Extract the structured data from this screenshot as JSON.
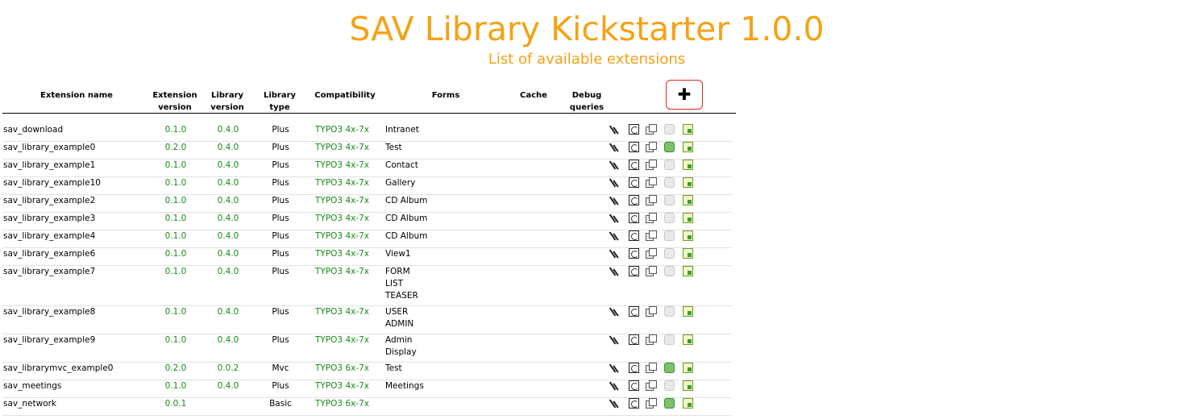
{
  "header": {
    "title": "SAV Library Kickstarter 1.0.0",
    "subtitle": "List of available extensions"
  },
  "columns": {
    "name": "Extension name",
    "ext_version_1": "Extension",
    "ext_version_2": "version",
    "lib_version_1": "Library",
    "lib_version_2": "version",
    "lib_type_1": "Library",
    "lib_type_2": "type",
    "compat": "Compatibility",
    "forms": "Forms",
    "cache": "Cache",
    "debug_1": "Debug",
    "debug_2": "queries"
  },
  "add_button": {
    "symbol": "✚"
  },
  "icons": [
    "edit-icon",
    "regenerate-icon",
    "copy-icon",
    "cache-icon",
    "document-icon"
  ],
  "rows": [
    {
      "name": "sav_download",
      "ext_version": "0.1.0",
      "lib_version": "0.4.0",
      "lib_type": "Plus",
      "compat": "TYPO3 4x-7x",
      "forms": [
        "Intranet"
      ],
      "cache_on": false
    },
    {
      "name": "sav_library_example0",
      "ext_version": "0.2.0",
      "lib_version": "0.4.0",
      "lib_type": "Plus",
      "compat": "TYPO3 4x-7x",
      "forms": [
        "Test"
      ],
      "cache_on": true
    },
    {
      "name": "sav_library_example1",
      "ext_version": "0.1.0",
      "lib_version": "0.4.0",
      "lib_type": "Plus",
      "compat": "TYPO3 4x-7x",
      "forms": [
        "Contact"
      ],
      "cache_on": false
    },
    {
      "name": "sav_library_example10",
      "ext_version": "0.1.0",
      "lib_version": "0.4.0",
      "lib_type": "Plus",
      "compat": "TYPO3 4x-7x",
      "forms": [
        "Gallery"
      ],
      "cache_on": false
    },
    {
      "name": "sav_library_example2",
      "ext_version": "0.1.0",
      "lib_version": "0.4.0",
      "lib_type": "Plus",
      "compat": "TYPO3 4x-7x",
      "forms": [
        "CD Album"
      ],
      "cache_on": false
    },
    {
      "name": "sav_library_example3",
      "ext_version": "0.1.0",
      "lib_version": "0.4.0",
      "lib_type": "Plus",
      "compat": "TYPO3 4x-7x",
      "forms": [
        "CD Album"
      ],
      "cache_on": false
    },
    {
      "name": "sav_library_example4",
      "ext_version": "0.1.0",
      "lib_version": "0.4.0",
      "lib_type": "Plus",
      "compat": "TYPO3 4x-7x",
      "forms": [
        "CD Album"
      ],
      "cache_on": false
    },
    {
      "name": "sav_library_example6",
      "ext_version": "0.1.0",
      "lib_version": "0.4.0",
      "lib_type": "Plus",
      "compat": "TYPO3 4x-7x",
      "forms": [
        "View1"
      ],
      "cache_on": false
    },
    {
      "name": "sav_library_example7",
      "ext_version": "0.1.0",
      "lib_version": "0.4.0",
      "lib_type": "Plus",
      "compat": "TYPO3 4x-7x",
      "forms": [
        "FORM",
        "LIST",
        "TEASER"
      ],
      "cache_on": false
    },
    {
      "name": "sav_library_example8",
      "ext_version": "0.1.0",
      "lib_version": "0.4.0",
      "lib_type": "Plus",
      "compat": "TYPO3 4x-7x",
      "forms": [
        "USER",
        "ADMIN"
      ],
      "cache_on": false
    },
    {
      "name": "sav_library_example9",
      "ext_version": "0.1.0",
      "lib_version": "0.4.0",
      "lib_type": "Plus",
      "compat": "TYPO3 4x-7x",
      "forms": [
        "Admin",
        "Display"
      ],
      "cache_on": false
    },
    {
      "name": "sav_librarymvc_example0",
      "ext_version": "0.2.0",
      "lib_version": "0.0.2",
      "lib_type": "Mvc",
      "compat": "TYPO3 6x-7x",
      "forms": [
        "Test"
      ],
      "cache_on": true
    },
    {
      "name": "sav_meetings",
      "ext_version": "0.1.0",
      "lib_version": "0.4.0",
      "lib_type": "Plus",
      "compat": "TYPO3 4x-7x",
      "forms": [
        "Meetings"
      ],
      "cache_on": false
    },
    {
      "name": "sav_network",
      "ext_version": "0.0.1",
      "lib_version": "",
      "lib_type": "Basic",
      "compat": "TYPO3 6x-7x",
      "forms": [],
      "cache_on": true
    }
  ]
}
